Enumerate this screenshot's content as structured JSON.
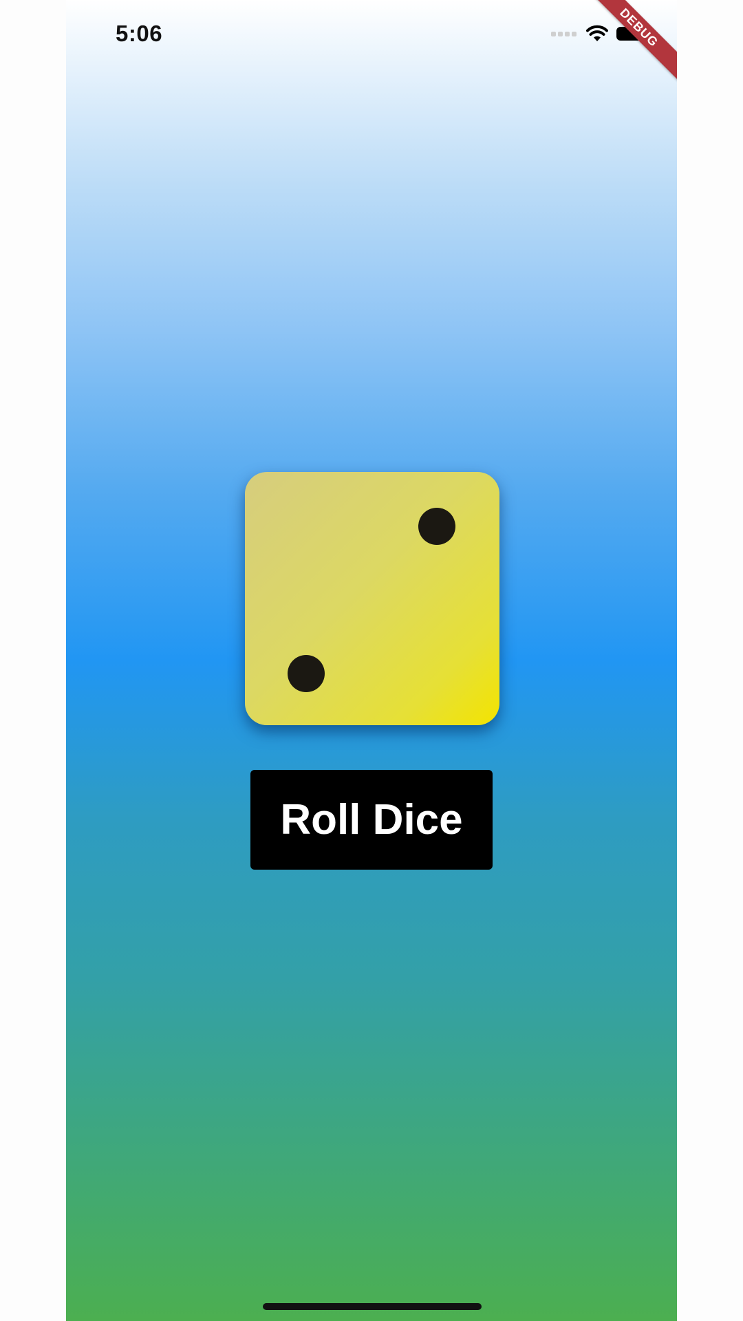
{
  "status_bar": {
    "time": "5:06",
    "icons": [
      "signal-icon",
      "wifi-icon",
      "battery-icon"
    ]
  },
  "debug_banner": {
    "label": "DEBUG"
  },
  "dice": {
    "value": 2,
    "colors": {
      "face_start": "#d6cd7e",
      "face_end": "#f3e400",
      "pip": "#1b1812"
    }
  },
  "roll_button": {
    "label": "Roll Dice",
    "background": "#000000",
    "text_color": "#ffffff"
  },
  "background": {
    "gradient": [
      "#ffffff",
      "#2196f3",
      "#4caf50"
    ]
  }
}
